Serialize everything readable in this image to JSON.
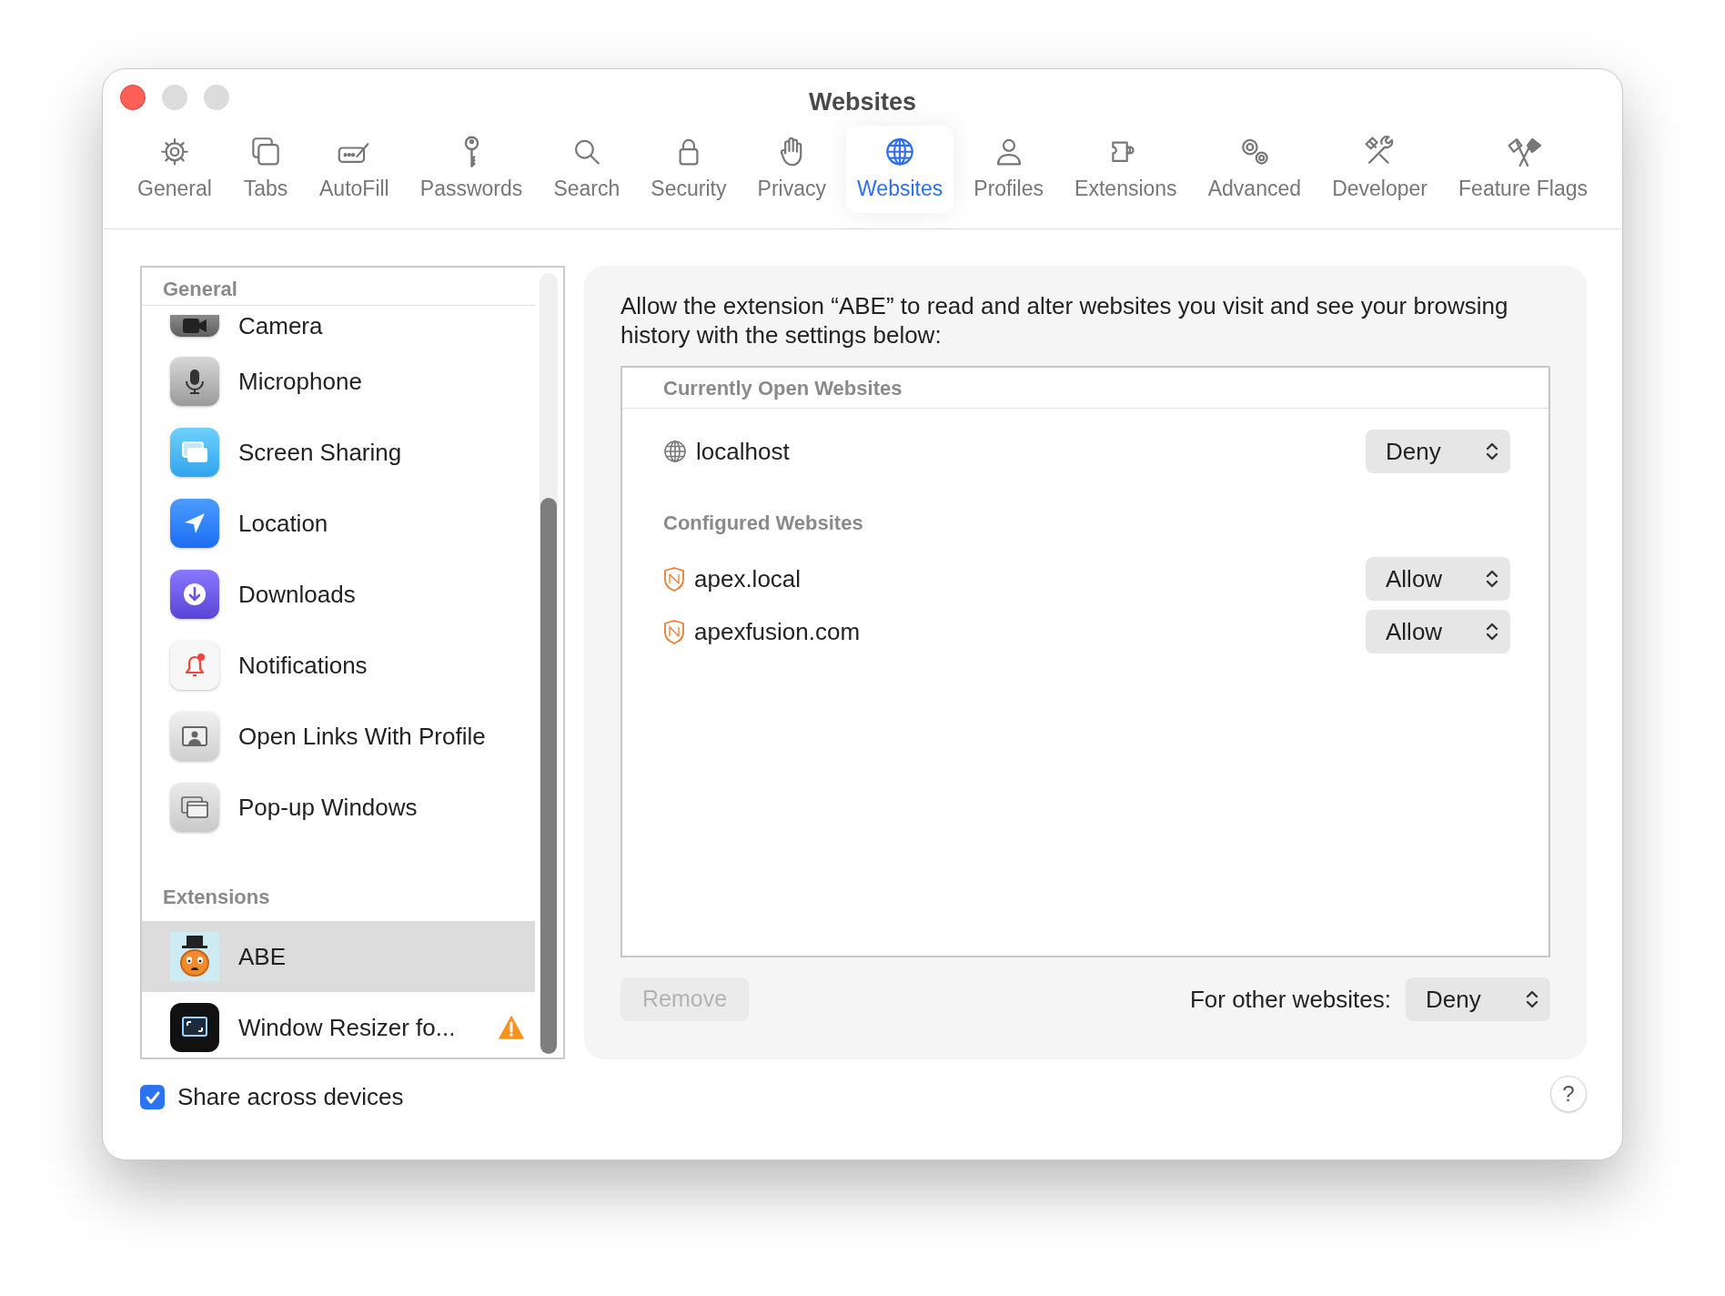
{
  "window": {
    "title": "Websites"
  },
  "toolbar": [
    {
      "label": "General",
      "selected": false
    },
    {
      "label": "Tabs",
      "selected": false
    },
    {
      "label": "AutoFill",
      "selected": false
    },
    {
      "label": "Passwords",
      "selected": false
    },
    {
      "label": "Search",
      "selected": false
    },
    {
      "label": "Security",
      "selected": false
    },
    {
      "label": "Privacy",
      "selected": false
    },
    {
      "label": "Websites",
      "selected": true
    },
    {
      "label": "Profiles",
      "selected": false
    },
    {
      "label": "Extensions",
      "selected": false
    },
    {
      "label": "Advanced",
      "selected": false
    },
    {
      "label": "Developer",
      "selected": false
    },
    {
      "label": "Feature Flags",
      "selected": false
    }
  ],
  "sidebar": {
    "general_header": "General",
    "general_items": [
      {
        "label": "Camera",
        "selected": false
      },
      {
        "label": "Microphone",
        "selected": false
      },
      {
        "label": "Screen Sharing",
        "selected": false
      },
      {
        "label": "Location",
        "selected": false
      },
      {
        "label": "Downloads",
        "selected": false
      },
      {
        "label": "Notifications",
        "selected": false
      },
      {
        "label": "Open Links With Profile",
        "selected": false
      },
      {
        "label": "Pop-up Windows",
        "selected": false
      }
    ],
    "extensions_header": "Extensions",
    "extension_items": [
      {
        "label": "ABE",
        "selected": true,
        "warning": false
      },
      {
        "label": "Window Resizer fo...",
        "selected": false,
        "warning": true
      }
    ]
  },
  "detail": {
    "description": "Allow the extension “ABE” to read and alter websites you visit and see your browsing history with the settings below:",
    "sections": [
      {
        "header": "Currently Open Websites",
        "sites": [
          {
            "kind": "globe",
            "host": "localhost",
            "permission": "Deny"
          }
        ]
      },
      {
        "header": "Configured Websites",
        "sites": [
          {
            "kind": "shield",
            "host": "apex.local",
            "permission": "Allow"
          },
          {
            "kind": "shield",
            "host": "apexfusion.com",
            "permission": "Allow"
          }
        ]
      }
    ],
    "remove_button": {
      "label": "Remove",
      "disabled": true
    },
    "other_label": "For other websites:",
    "other_permission": "Deny"
  },
  "share": {
    "label": "Share across devices",
    "checked": true
  },
  "help": "?"
}
